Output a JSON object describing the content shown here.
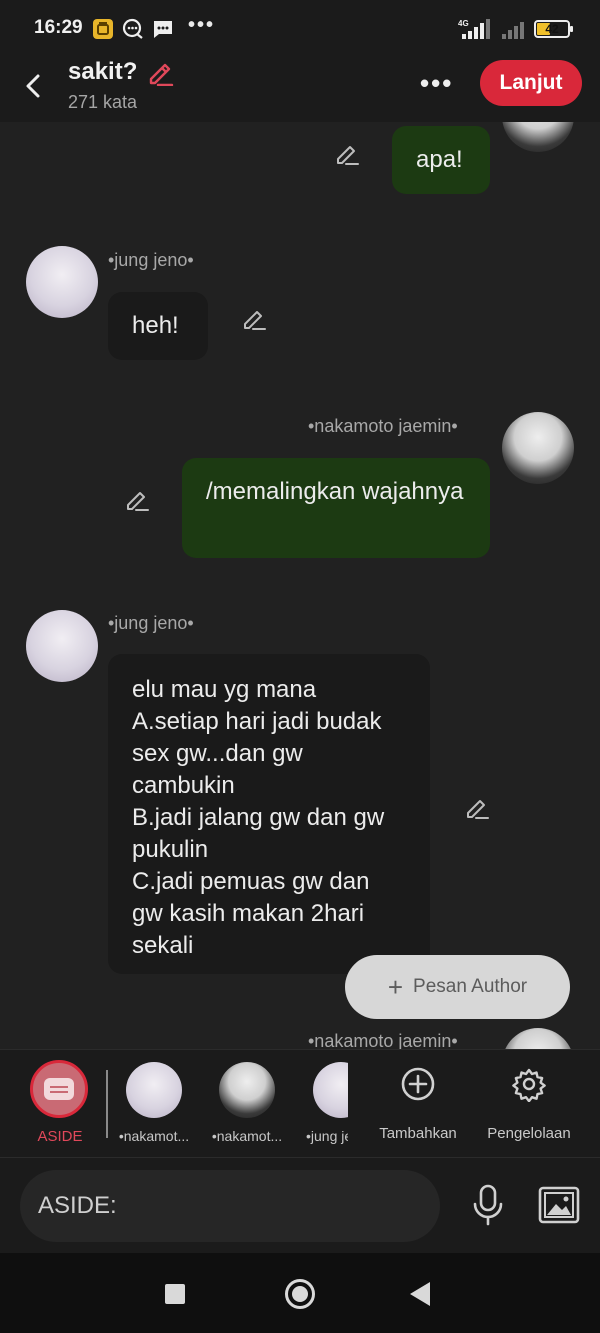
{
  "status_bar": {
    "time": "16:29",
    "network": "4G",
    "battery": "42"
  },
  "header": {
    "title": "sakit?",
    "subtitle": "271 kata",
    "next_label": "Lanjut"
  },
  "messages": [
    {
      "side": "right",
      "speaker": "",
      "text": "apa!",
      "style": "green"
    },
    {
      "side": "left",
      "speaker": "•jung jeno•",
      "text": "heh!",
      "style": "dark"
    },
    {
      "side": "right",
      "speaker": "•nakamoto jaemin•",
      "text": "/memalingkan wajahnya",
      "style": "green"
    },
    {
      "side": "left",
      "speaker": "•jung jeno•",
      "text": "elu mau yg mana\nA.setiap hari jadi budak sex gw...dan gw cambukin\nB.jadi jalang gw dan gw pukulin\nC.jadi pemuas gw dan gw kasih makan 2hari sekali",
      "style": "dark"
    },
    {
      "side": "right",
      "speaker": "•nakamoto jaemin•",
      "text": "",
      "style": "green"
    }
  ],
  "floating_button": {
    "label": "Pesan Author"
  },
  "character_bar": {
    "aside_label": "ASIDE",
    "characters": [
      "•nakamot...",
      "•nakamot...",
      "•jung je"
    ],
    "add_label": "Tambahkan",
    "manage_label": "Pengelolaan"
  },
  "input": {
    "placeholder": "ASIDE:"
  },
  "colors": {
    "accent_red": "#d9283a",
    "bubble_green": "#1c3a12",
    "bubble_dark": "#1a1a1a",
    "background": "#212121"
  }
}
